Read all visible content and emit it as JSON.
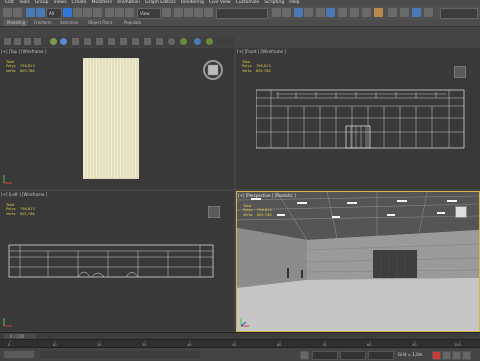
{
  "menu": [
    "Edit",
    "Tools",
    "Group",
    "Views",
    "Create",
    "Modifiers",
    "Animation",
    "Graph Editors",
    "Rendering",
    "Civil View",
    "Customize",
    "Scripting",
    "Help"
  ],
  "toolbar": {
    "filter_value": "All",
    "view_value": "View",
    "selection_set": ""
  },
  "ribbon": {
    "tabs": [
      "Modeling",
      "Freeform",
      "Selection",
      "Object Paint",
      "Populate"
    ]
  },
  "viewports": {
    "top": {
      "label": "[+] [Top ] [Wireframe ]",
      "stats_title": "Total",
      "polys": "Polys:   796,813",
      "verts": "Verts:   605,786"
    },
    "front": {
      "label": "[+] [Front ] [Wireframe ]",
      "stats_title": "Total",
      "polys": "Polys:   796,813",
      "verts": "Verts:   605,786"
    },
    "left": {
      "label": "[+] [Left ] [Wireframe ]",
      "stats_title": "Total",
      "polys": "Polys:   796,813",
      "verts": "Verts:   605,786"
    },
    "persp": {
      "label": "[+] [Perspective ] [Realistic ]",
      "stats_title": "Total",
      "polys": "Polys:   796,813",
      "verts": "Verts:   605,786"
    }
  },
  "timeline": {
    "slider": "0 / 100",
    "ticks": [
      "0",
      "10",
      "20",
      "30",
      "40",
      "50",
      "60",
      "70",
      "80",
      "90",
      "100"
    ]
  },
  "grid_label": "Grid = 1,0m",
  "colors": {
    "active_border": "#d9b44a",
    "stats": "#d8c84a",
    "wire": "#d6d6d6"
  }
}
